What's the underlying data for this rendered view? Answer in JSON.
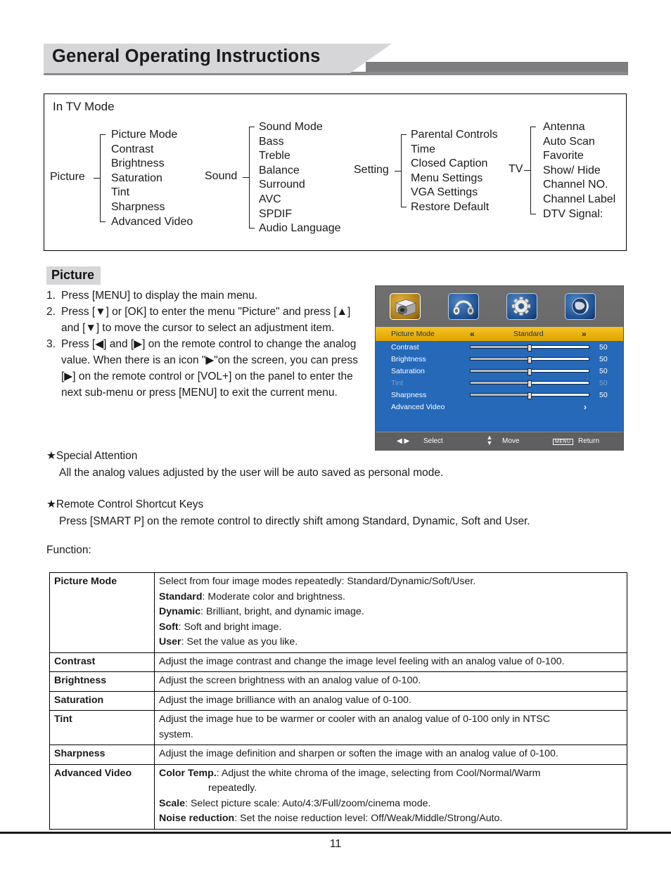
{
  "header": {
    "title": "General Operating Instructions"
  },
  "tree_box": {
    "title": "In TV Mode",
    "groups": [
      {
        "root": "Picture",
        "items": [
          "Picture Mode",
          "Contrast",
          "Brightness",
          "Saturation",
          "Tint",
          "Sharpness",
          "Advanced Video"
        ]
      },
      {
        "root": "Sound",
        "items": [
          "Sound Mode",
          "Bass",
          "Treble",
          "Balance",
          "Surround",
          "AVC",
          "SPDIF",
          "Audio Language"
        ]
      },
      {
        "root": "Setting",
        "items": [
          "Parental Controls",
          "Time",
          "Closed Caption",
          "Menu Settings",
          "VGA Settings",
          "Restore Default"
        ]
      },
      {
        "root": "TV",
        "items": [
          "Antenna",
          "Auto Scan",
          "Favorite",
          "Show/ Hide",
          "Channel NO.",
          "Channel Label",
          "DTV Signal:"
        ]
      }
    ]
  },
  "picture_section": {
    "heading": "Picture",
    "steps": [
      {
        "num": "1.",
        "text": "Press [MENU] to display the main menu."
      },
      {
        "num": "2.",
        "text": "Press [▼] or [OK] to enter the menu \"Picture\" and press [▲] and [▼] to move the cursor to select an adjustment item."
      },
      {
        "num": "3.",
        "text": "Press [◀] and [▶] on the remote control to change the analog value. When there is an icon \"▶\"on the screen, you can press [▶] on the remote control or [VOL+] on the panel to enter the next sub-menu or press [MENU] to exit the current menu."
      }
    ]
  },
  "osd": {
    "icons": [
      {
        "name": "picture-camera-icon",
        "selected": true
      },
      {
        "name": "sound-headphones-icon",
        "selected": false
      },
      {
        "name": "settings-gear-icon",
        "selected": false
      },
      {
        "name": "tv-globe-icon",
        "selected": false
      }
    ],
    "highlight_row": {
      "label": "Picture Mode",
      "left_arrow": "«",
      "value": "Standard",
      "right_arrow": "»"
    },
    "rows": [
      {
        "label": "Contrast",
        "value": "50",
        "dim": false,
        "type": "slider"
      },
      {
        "label": "Brightness",
        "value": "50",
        "dim": false,
        "type": "slider"
      },
      {
        "label": "Saturation",
        "value": "50",
        "dim": false,
        "type": "slider"
      },
      {
        "label": "Tint",
        "value": "50",
        "dim": true,
        "type": "slider"
      },
      {
        "label": "Sharpness",
        "value": "50",
        "dim": false,
        "type": "slider"
      },
      {
        "label": "Advanced Video",
        "value": "›",
        "dim": false,
        "type": "submenu"
      }
    ],
    "footer": {
      "left_arrows": "◀  ▶",
      "select": "Select",
      "updown": "▲▼",
      "move": "Move",
      "menu_key": "MENU",
      "return": "Return"
    },
    "colors": {
      "highlight": "#e8b21c",
      "panel_blue": "#2569b8",
      "chrome_grey": "#6d6d6d"
    }
  },
  "notes": [
    {
      "title": "★Special Attention",
      "body": "All the analog values adjusted by the user will be auto saved as personal mode."
    },
    {
      "title": "★Remote Control Shortcut Keys",
      "body": "Press [SMART P] on the remote control to directly shift among Standard, Dynamic, Soft and User."
    }
  ],
  "function_label": "Function:",
  "function_table": [
    {
      "key": "Picture Mode",
      "lines": [
        {
          "bold": "",
          "rest": "Select from four image modes repeatedly: Standard/Dynamic/Soft/User.",
          "indent": false
        },
        {
          "bold": "Standard",
          "rest": ": Moderate color and brightness.",
          "indent": false
        },
        {
          "bold": "Dynamic",
          "rest": ": Brilliant, bright, and dynamic image.",
          "indent": false
        },
        {
          "bold": "Soft",
          "rest": ": Soft and bright image.",
          "indent": false
        },
        {
          "bold": "User",
          "rest": ": Set the value as you like.",
          "indent": false
        }
      ]
    },
    {
      "key": "Contrast",
      "lines": [
        {
          "bold": "",
          "rest": "Adjust the image contrast and change the image level feeling with an analog value of 0-100.",
          "indent": false
        }
      ]
    },
    {
      "key": "Brightness",
      "lines": [
        {
          "bold": "",
          "rest": "Adjust the screen brightness with an analog value of 0-100.",
          "indent": false
        }
      ]
    },
    {
      "key": "Saturation",
      "lines": [
        {
          "bold": "",
          "rest": "Adjust the image brilliance with an analog value of 0-100.",
          "indent": false
        }
      ]
    },
    {
      "key": "Tint",
      "lines": [
        {
          "bold": "",
          "rest": "Adjust the image hue to be warmer or cooler with an analog value of 0-100 only in NTSC",
          "indent": false
        },
        {
          "bold": "",
          "rest": "system.",
          "indent": false
        }
      ]
    },
    {
      "key": "Sharpness",
      "lines": [
        {
          "bold": "",
          "rest": "Adjust the image definition and sharpen or soften the image with an analog value of 0-100.",
          "indent": false
        }
      ]
    },
    {
      "key": "Advanced Video",
      "lines": [
        {
          "bold": "Color Temp.",
          "rest": ": Adjust the white chroma of the image, selecting from Cool/Normal/Warm",
          "indent": false
        },
        {
          "bold": "",
          "rest": "repeatedly.",
          "indent": true
        },
        {
          "bold": "Scale",
          "rest": ": Select picture scale: Auto/4:3/Full/zoom/cinema mode.",
          "indent": false
        },
        {
          "bold": "Noise reduction",
          "rest": ": Set the noise reduction level: Off/Weak/Middle/Strong/Auto.",
          "indent": false
        }
      ]
    }
  ],
  "footer": {
    "page_number": "11"
  }
}
